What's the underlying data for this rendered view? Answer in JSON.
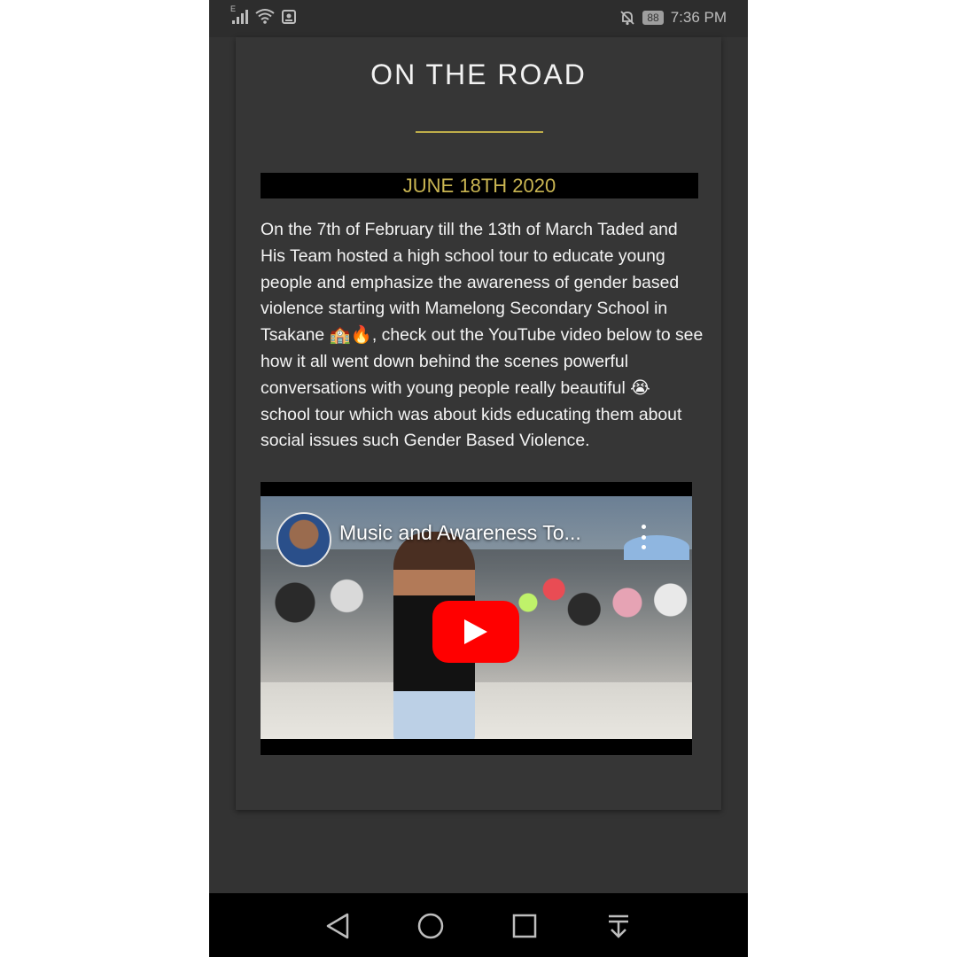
{
  "status_bar": {
    "network_type": "E",
    "battery_level": "88",
    "time": "7:36 PM",
    "icons": [
      "signal-icon",
      "wifi-icon",
      "screenshot-icon",
      "mute-icon",
      "battery-icon"
    ]
  },
  "section": {
    "title": "ON THE ROAD",
    "date": "JUNE 18TH 2020",
    "body": "On the 7th of February till the 13th of March Taded and His Team hosted a high school tour to educate young people and emphasize the awareness of gender based violence starting with Mamelong Secondary School in Tsakane 🏫🔥, check out the YouTube video below to see how it all went down behind the scenes powerful conversations with young people really beautiful 😭\nschool tour which was about kids educating them about social issues such Gender Based Violence."
  },
  "video": {
    "title": "Music and Awareness To...",
    "icons": [
      "channel-avatar",
      "more-options-icon",
      "play-icon"
    ]
  },
  "nav_bar": {
    "icons": [
      "back-icon",
      "home-icon",
      "recents-icon",
      "notification-pull-icon"
    ]
  },
  "colors": {
    "accent_gold": "#c9b552",
    "page_bg": "#333333",
    "card_bg": "#363636",
    "youtube_red": "#ff0000"
  }
}
